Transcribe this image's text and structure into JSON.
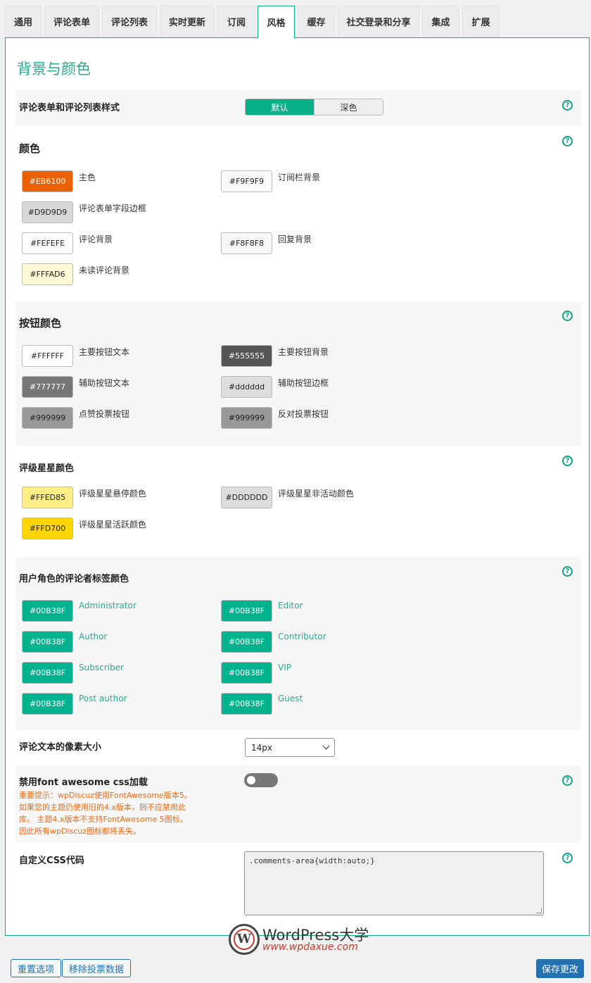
{
  "tabs": [
    "通用",
    "评论表单",
    "评论列表",
    "实时更新",
    "订阅",
    "风格",
    "缓存",
    "社交登录和分享",
    "集成",
    "扩展"
  ],
  "active_tab": "风格",
  "heading": "背景与颜色",
  "help_symbol": "?",
  "style_section": {
    "label": "评论表单和评论列表样式",
    "options": [
      "默认",
      "深色"
    ],
    "selected": "默认"
  },
  "colors": {
    "title": "颜色",
    "items": [
      {
        "value": "#EB6100",
        "label": "主色",
        "bg": "#EB6100",
        "fg": "#ffffff"
      },
      {
        "value": "#F9F9F9",
        "label": "订阅栏背景",
        "bg": "#F9F9F9",
        "fg": "#222222"
      },
      {
        "value": "#D9D9D9",
        "label": "评论表单字段边框",
        "bg": "#D9D9D9",
        "fg": "#222222"
      },
      {
        "value": "#FEFEFE",
        "label": "评论背景",
        "bg": "#FEFEFE",
        "fg": "#222222"
      },
      {
        "value": "#F8F8F8",
        "label": "回复背景",
        "bg": "#F8F8F8",
        "fg": "#222222"
      },
      {
        "value": "#FFFAD6",
        "label": "未读评论背景",
        "bg": "#FFFAD6",
        "fg": "#222222"
      }
    ]
  },
  "button_colors": {
    "title": "按钮颜色",
    "items": [
      {
        "value": "#FFFFFF",
        "label": "主要按钮文本",
        "bg": "#FFFFFF",
        "fg": "#222222"
      },
      {
        "value": "#555555",
        "label": "主要按钮背景",
        "bg": "#555555",
        "fg": "#ffffff"
      },
      {
        "value": "#777777",
        "label": "辅助按钮文本",
        "bg": "#777777",
        "fg": "#ffffff"
      },
      {
        "value": "#dddddd",
        "label": "辅助按钮边框",
        "bg": "#dddddd",
        "fg": "#222222"
      },
      {
        "value": "#999999",
        "label": "点赞投票按钮",
        "bg": "#999999",
        "fg": "#222222"
      },
      {
        "value": "#999999",
        "label": "反对投票按钮",
        "bg": "#999999",
        "fg": "#222222"
      }
    ]
  },
  "star_colors": {
    "title": "评级星星颜色",
    "items": [
      {
        "value": "#FFED85",
        "label": "评级星星悬停颜色",
        "bg": "#FFED85",
        "fg": "#222222"
      },
      {
        "value": "#DDDDDD",
        "label": "评级星星非活动颜色",
        "bg": "#DDDDDD",
        "fg": "#222222"
      },
      {
        "value": "#FFD700",
        "label": "评级星星活跃颜色",
        "bg": "#FFD700",
        "fg": "#222222"
      }
    ]
  },
  "role_colors": {
    "title": "用户角色的评论者标签颜色",
    "items": [
      {
        "value": "#00B38F",
        "label": "Administrator"
      },
      {
        "value": "#00B38F",
        "label": "Editor"
      },
      {
        "value": "#00B38F",
        "label": "Author"
      },
      {
        "value": "#00B38F",
        "label": "Contributor"
      },
      {
        "value": "#00B38F",
        "label": "Subscriber"
      },
      {
        "value": "#00B38F",
        "label": "VIP"
      },
      {
        "value": "#00B38F",
        "label": "Post author"
      },
      {
        "value": "#00B38F",
        "label": "Guest"
      }
    ]
  },
  "font_size": {
    "label": "评论文本的像素大小",
    "value": "14px"
  },
  "font_awesome": {
    "label": "禁用font awesome css加载",
    "enabled": false,
    "warning": "重要提示：wpDiscuz使用FontAwesome版本5。如果您的主题仍使用旧的4.x版本，则不应禁用此库。 主题4.x版本不支持FontAwesome 5图标，因此所有wpDiscuz图标都将丢失。"
  },
  "custom_css": {
    "label": "自定义CSS代码",
    "value": ".comments-area{width:auto;}"
  },
  "footer": {
    "reset": "重置选项",
    "remove_votes": "移除投票数据",
    "save": "保存更改"
  },
  "watermark": {
    "title": "WordPress大学",
    "url": "www.wpdaxue.com",
    "logo_letter": "W"
  },
  "accent": "#00b38f"
}
